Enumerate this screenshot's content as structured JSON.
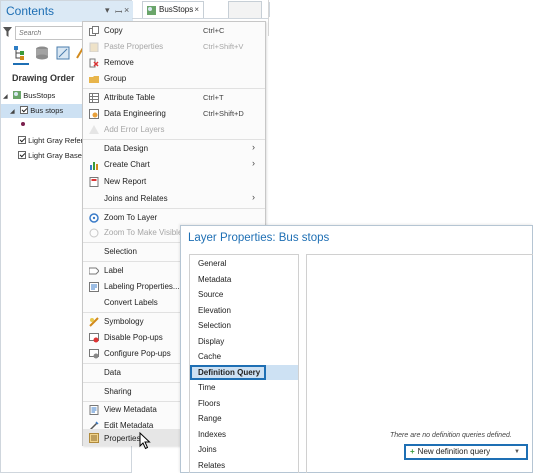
{
  "contents": {
    "title": "Contents",
    "search_placeholder": "Search",
    "drawing_order": "Drawing Order",
    "tree": {
      "map": "BusStops",
      "bus_stops": "Bus stops",
      "light_gray_reference": "Light Gray Refer",
      "light_gray_base": "Light Gray Base"
    }
  },
  "tabs": {
    "active_tab": "BusStops",
    "close": "×"
  },
  "context_menu": {
    "copy": "Copy",
    "copy_shortcut": "Ctrl+C",
    "paste_properties": "Paste Properties",
    "paste_properties_shortcut": "Ctrl+Shift+V",
    "remove": "Remove",
    "group": "Group",
    "attribute_table": "Attribute Table",
    "attribute_table_shortcut": "Ctrl+T",
    "data_engineering": "Data Engineering",
    "data_engineering_shortcut": "Ctrl+Shift+D",
    "add_error_layers": "Add Error Layers",
    "data_design": "Data Design",
    "create_chart": "Create Chart",
    "new_report": "New Report",
    "joins_and_relates": "Joins and Relates",
    "zoom_to_layer": "Zoom To Layer",
    "zoom_to_make_visible": "Zoom To Make Visible",
    "selection": "Selection",
    "label": "Label",
    "labeling_properties": "Labeling Properties...",
    "convert_labels": "Convert Labels",
    "symbology": "Symbology",
    "disable_popups": "Disable Pop-ups",
    "configure_popups": "Configure Pop-ups",
    "data": "Data",
    "sharing": "Sharing",
    "view_metadata": "View Metadata",
    "edit_metadata": "Edit Metadata",
    "properties": "Properties"
  },
  "layer_properties": {
    "title": "Layer Properties: Bus stops",
    "nav": [
      "General",
      "Metadata",
      "Source",
      "Elevation",
      "Selection",
      "Display",
      "Cache",
      "Definition Query",
      "Time",
      "Floors",
      "Range",
      "Indexes",
      "Joins",
      "Relates"
    ],
    "selected_nav": "Definition Query",
    "empty_message": "There are no definition queries defined.",
    "new_query_button": "New definition query"
  },
  "colors": {
    "accent": "#1e6fb4",
    "selection": "#cde1f3",
    "title_bar": "#dbe9f5"
  }
}
